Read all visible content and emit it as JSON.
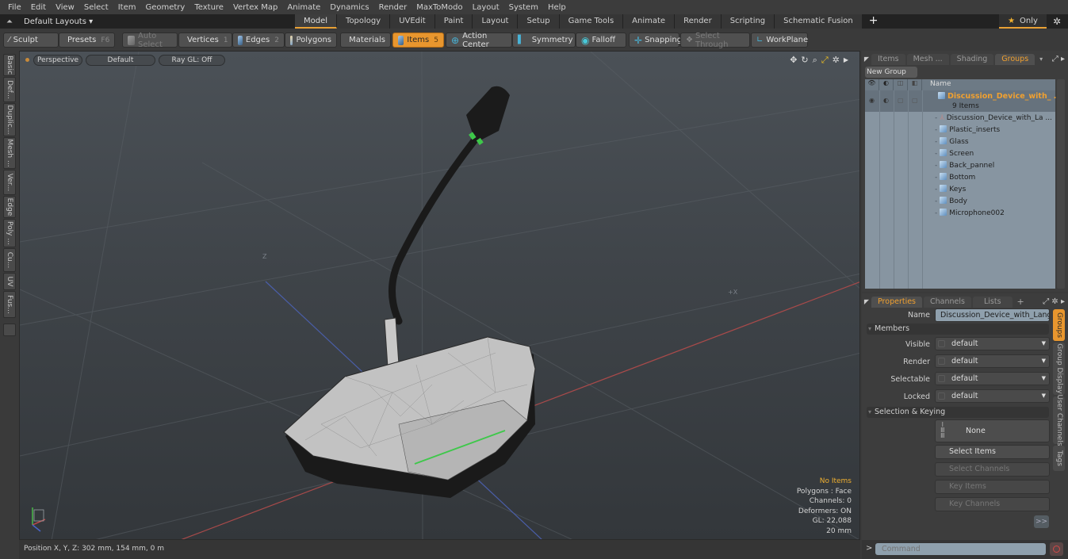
{
  "menu": [
    "File",
    "Edit",
    "View",
    "Select",
    "Item",
    "Geometry",
    "Texture",
    "Vertex Map",
    "Animate",
    "Dynamics",
    "Render",
    "MaxToModo",
    "Layout",
    "System",
    "Help"
  ],
  "layout_bar": {
    "layouts_label": "Default Layouts ▾",
    "tabs": [
      "Model",
      "Topology",
      "UVEdit",
      "Paint",
      "Layout",
      "Setup",
      "Game Tools",
      "Animate",
      "Render",
      "Scripting",
      "Schematic Fusion"
    ],
    "active_tab": "Model",
    "add_tab": "+",
    "only_label": "Only"
  },
  "toolbar": {
    "sculpt": "Sculpt",
    "presets": "Presets",
    "presets_key": "F6",
    "auto_select": "Auto Select",
    "vertices": "Vertices",
    "vertices_key": "1",
    "edges": "Edges",
    "edges_key": "2",
    "polygons": "Polygons",
    "materials": "Materials",
    "items": "Items",
    "items_key": "5",
    "action_center": "Action Center",
    "symmetry": "Symmetry",
    "falloff": "Falloff",
    "snapping": "Snapping",
    "select_through": "Select Through",
    "workplane": "WorkPlane"
  },
  "left_tabs": [
    "Basic",
    "Def...",
    "Duplic...",
    "Mesh ...",
    "Ver...",
    "Edge",
    "Poly ...",
    "Cu...",
    "UV",
    "Fus..."
  ],
  "viewport": {
    "view_mode": "Perspective",
    "shading": "Default",
    "raygl": "Ray GL: Off",
    "axis_labels": {
      "z": "Z",
      "x": "+X"
    },
    "hud": {
      "selection": "No Items",
      "polygons": "Polygons : Face",
      "channels": "Channels: 0",
      "deformers": "Deformers: ON",
      "gl": "GL: 22,088",
      "scale": "20 mm"
    }
  },
  "status": {
    "position": "Position X, Y, Z:   302 mm, 154 mm, 0 m"
  },
  "groups_panel": {
    "tabs": [
      "Items",
      "Mesh ...",
      "Shading",
      "Groups"
    ],
    "active_tab": "Groups",
    "new_group": "New Group",
    "name_header": "Name",
    "root": {
      "name": "Discussion_Device_with_ ...",
      "count": "9 Items"
    },
    "children": [
      "Discussion_Device_with_La ...",
      "Plastic_inserts",
      "Glass",
      "Screen",
      "Back_pannel",
      "Bottom",
      "Keys",
      "Body",
      "Microphone002"
    ]
  },
  "properties_panel": {
    "tabs": [
      "Properties",
      "Channels",
      "Lists"
    ],
    "active_tab": "Properties",
    "add_tab": "+",
    "name_label": "Name",
    "name_value": "Discussion_Device_with_Languag",
    "members_section": "Members",
    "fields": [
      {
        "label": "Visible",
        "value": "default"
      },
      {
        "label": "Render",
        "value": "default"
      },
      {
        "label": "Selectable",
        "value": "default"
      },
      {
        "label": "Locked",
        "value": "default"
      }
    ],
    "selection_section": "Selection & Keying",
    "none_button": "None",
    "buttons": [
      {
        "label": "Select Items",
        "enabled": true
      },
      {
        "label": "Select Channels",
        "enabled": false
      },
      {
        "label": "Key Items",
        "enabled": false
      },
      {
        "label": "Key Channels",
        "enabled": false
      }
    ],
    "more": ">>",
    "side_tabs": [
      "Groups",
      "Group Display",
      "User Channels",
      "Tags"
    ],
    "active_side_tab": "Groups"
  },
  "command": {
    "prompt": ">",
    "placeholder": "Command"
  },
  "colors": {
    "accent": "#e8962e",
    "active_text": "#f0a030",
    "viewport_bg": "#3f4449"
  }
}
